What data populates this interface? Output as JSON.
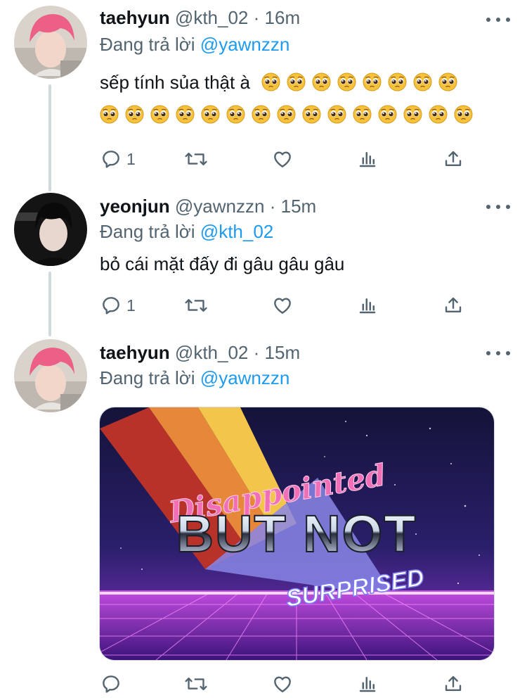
{
  "tweets": [
    {
      "name": "taehyun",
      "handle": "@kth_02",
      "separator": "·",
      "time": "16m",
      "reply_prefix": "Đang trả lời",
      "reply_to": "@yawnzzn",
      "text": "sếp tính sủa thật à",
      "emoji": "pleading-face",
      "emoji_count_line1": 8,
      "emoji_count_line2": 15,
      "reply_count": "1",
      "avatar": "avatar-pink-hair"
    },
    {
      "name": "yeonjun",
      "handle": "@yawnzzn",
      "separator": "·",
      "time": "15m",
      "reply_prefix": "Đang trả lời",
      "reply_to": "@kth_02",
      "text": "bỏ cái mặt đấy đi gâu gâu gâu",
      "reply_count": "1",
      "avatar": "avatar-dark-hair"
    },
    {
      "name": "taehyun",
      "handle": "@kth_02",
      "separator": "·",
      "time": "15m",
      "reply_prefix": "Đang trả lời",
      "reply_to": "@yawnzzn",
      "avatar": "avatar-pink-hair",
      "media": {
        "line1": "Disappointed",
        "line2": "BUT NOT",
        "line3": "SURPRISED"
      }
    }
  ],
  "icons": {
    "reply": "reply-icon",
    "retweet": "retweet-icon",
    "like": "heart-icon",
    "analytics": "analytics-icon",
    "share": "share-icon",
    "more": "more-icon"
  },
  "colors": {
    "mention": "#1d9bf0",
    "secondary_text": "#536471",
    "thread_line": "#cfd9de"
  }
}
